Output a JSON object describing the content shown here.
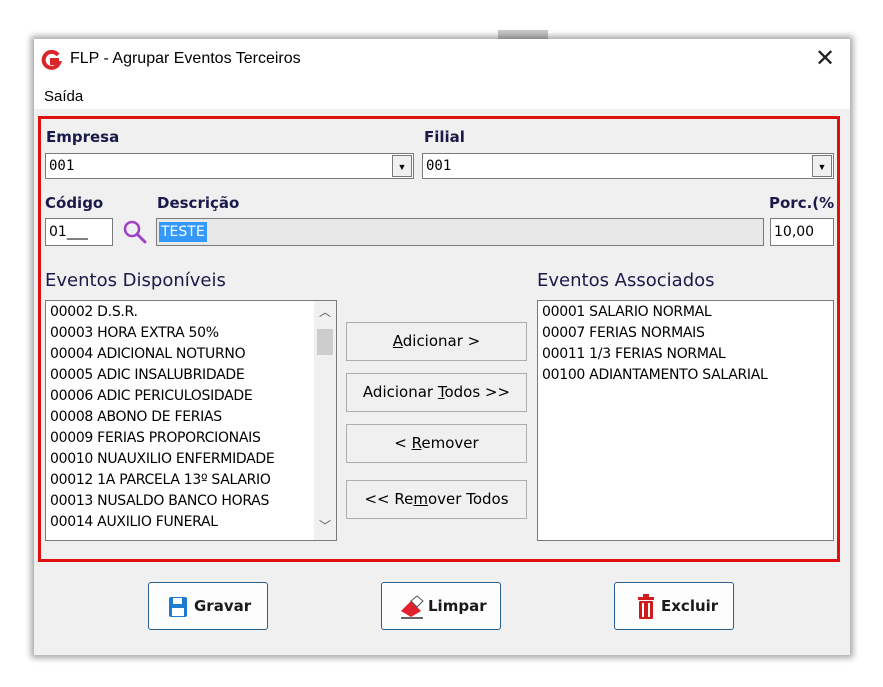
{
  "window": {
    "title": "FLP - Agrupar Eventos Terceiros",
    "close_glyph": "✕"
  },
  "menu": {
    "items": [
      "Saída"
    ]
  },
  "form": {
    "empresa_label": "Empresa",
    "empresa_value": "001",
    "filial_label": "Filial",
    "filial_value": "001",
    "codigo_label": "Código",
    "codigo_value": "01___",
    "descricao_label": "Descrição",
    "descricao_value": "TESTE",
    "porc_label": "Porc.(%",
    "porc_value": "10,00"
  },
  "available": {
    "label": "Eventos Disponíveis",
    "items": [
      "00002 D.S.R.",
      "00003 HORA EXTRA 50%",
      "00004 ADICIONAL NOTURNO",
      "00005 ADIC INSALUBRIDADE",
      "00006 ADIC PERICULOSIDADE",
      "00008 ABONO DE FERIAS",
      "00009 FERIAS PROPORCIONAIS",
      "00010 NUAUXILIO ENFERMIDADE",
      "00012 1A PARCELA 13º SALARIO",
      "00013 NUSALDO BANCO HORAS",
      "00014 AUXILIO FUNERAL"
    ]
  },
  "associated": {
    "label": "Eventos Associados",
    "items": [
      "00001 SALARIO NORMAL",
      "00007 FERIAS NORMAIS",
      "00011 1/3 FERIAS NORMAL",
      "00100 ADIANTAMENTO SALARIAL"
    ]
  },
  "actions": {
    "adicionar_pre": "",
    "adicionar_u": "A",
    "adicionar_post": "dicionar >",
    "adicionar_todos_pre": "Adicionar ",
    "adicionar_todos_u": "T",
    "adicionar_todos_post": "odos >>",
    "remover_pre": "< ",
    "remover_u": "R",
    "remover_post": "emover",
    "remover_todos_pre": "<< Re",
    "remover_todos_u": "m",
    "remover_todos_post": "over Todos"
  },
  "footer": {
    "gravar": "Gravar",
    "limpar": "Limpar",
    "excluir": "Excluir"
  },
  "colors": {
    "highlight_box": "#e01010",
    "label_text": "#1a1a4a",
    "selection": "#3399ff",
    "accent_logo": "#d9262b"
  }
}
